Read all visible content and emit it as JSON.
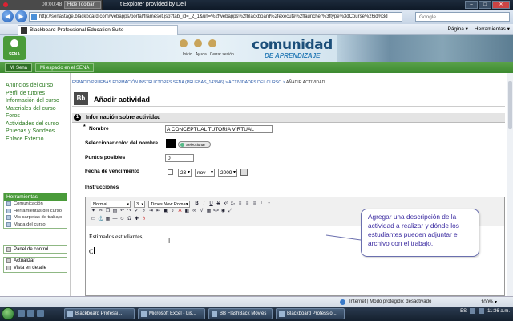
{
  "recorder": {
    "time": "00:00:48",
    "hide_label": "Hide Toolbar"
  },
  "window": {
    "title": "t Explorer provided by Dell",
    "min": "–",
    "max": "□",
    "close": "✕"
  },
  "address": {
    "url": "http://senastage.blackboard.com/webapps/portal/frameset.jsp?tab_id=_2_1&url=%2fwebapps%2fblackboard%2fexecute%2flauncher%3ftype%3dCourse%26id%3d",
    "search_placeholder": "Google"
  },
  "tab": {
    "title": "Blackboard Professional Education Suite"
  },
  "browser_tools": {
    "page": "Página ▾",
    "tools": "Herramientas ▾"
  },
  "header": {
    "logo_text": "SENA",
    "links": [
      "Inicio",
      "Ayuda",
      "Cerrar sesión"
    ],
    "brand_main": "comunidad",
    "brand_sub": "DE APRENDIZAJE"
  },
  "nav": {
    "tabs": [
      "Mi Sena",
      "Mi espacio en el SENA"
    ]
  },
  "sidebar": {
    "menu": [
      "Anuncios del curso",
      "Perfil de tutores",
      "Información del curso",
      "Materiales del curso",
      "Foros",
      "Actividades del curso",
      "Pruebas y Sondeos",
      "Enlace Externo"
    ],
    "tools_title": "Herramientas",
    "tools": [
      "Comunicación",
      "Herramientas del curso",
      "Mis carpetas de trabajo",
      "Mapa del curso"
    ],
    "panel": "Panel de control",
    "actions": [
      "Actualizar",
      "Vista en detalle"
    ]
  },
  "breadcrumb": {
    "parts": [
      "ESPACIO PRUEBAS FORMACIÓN INSTRUCTORES SENA (PRUEBAS_143346)",
      "ACTIVIDADES DEL CURSO"
    ],
    "current": "AÑADIR ACTIVIDAD",
    "sep": " > "
  },
  "page": {
    "icon": "Bb",
    "title": "Añadir actividad"
  },
  "section": {
    "number": "1",
    "title": "Información sobre actividad"
  },
  "form": {
    "req_marker": "*",
    "name_label": "Nombre",
    "name_value": "A CONCEPTUAL TUTORIA VIRTUAL",
    "color_label": "Seleccionar color del nombre",
    "color_button": "Seleccionar",
    "swatch_color": "#000000",
    "points_label": "Puntos posibles",
    "points_value": "0",
    "due_label": "Fecha de vencimiento",
    "due_day": "23",
    "due_month": "nov",
    "due_year": "2009",
    "instructions_label": "Instrucciones"
  },
  "editor": {
    "style": "Normal",
    "size": "3",
    "font": "Times New Roman",
    "content_line1": "Estimados estudiantes,",
    "content_line2": "C"
  },
  "callout": {
    "text": "Agregar una descripción de la actividad a realizar y dónde los estudiantes pueden adjuntar el archivo con el trabajo."
  },
  "status": {
    "zone": "Internet | Modo protegido: desactivado",
    "zoom": "100% ▾"
  },
  "taskbar": {
    "tasks": [
      "Blackboard Professi...",
      "Microsoft Excel - Lis...",
      "BB FlashBack Movies",
      "Blackboard Professio..."
    ],
    "lang": "ES",
    "clock": "11:36 a.m."
  },
  "colors": {
    "accent_green": "#4a9b3a",
    "link_green": "#2a7a1f",
    "callout_text": "#3a2aa0"
  }
}
